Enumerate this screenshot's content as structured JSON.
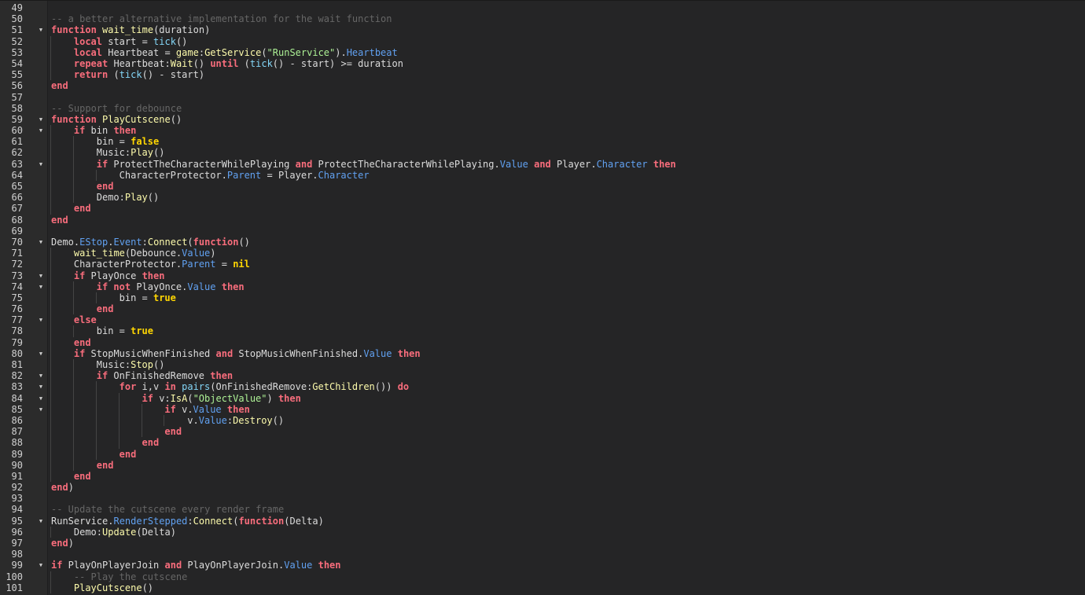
{
  "editor": {
    "background": "#252526",
    "colors": {
      "keyword": "#f86d7c",
      "bool": "#ffd602",
      "method": "#fdfbac",
      "property": "#61a1f1",
      "string": "#adf195",
      "comment": "#666666",
      "builtin": "#84d6f7",
      "text": "#dcdcdc"
    },
    "lines": [
      {
        "n": "49",
        "fold": false,
        "indent": 0,
        "tokens": []
      },
      {
        "n": "50",
        "fold": false,
        "indent": 0,
        "tokens": [
          [
            "cm",
            "-- a better alternative implementation for the wait function"
          ]
        ]
      },
      {
        "n": "51",
        "fold": true,
        "indent": 0,
        "tokens": [
          [
            "kw",
            "function"
          ],
          [
            "pl",
            " "
          ],
          [
            "fn",
            "wait_time"
          ],
          [
            "pl",
            "(duration)"
          ]
        ]
      },
      {
        "n": "52",
        "fold": false,
        "indent": 1,
        "tokens": [
          [
            "kw",
            "local"
          ],
          [
            "pl",
            " start = "
          ],
          [
            "bi",
            "tick"
          ],
          [
            "pl",
            "()"
          ]
        ]
      },
      {
        "n": "53",
        "fold": false,
        "indent": 1,
        "tokens": [
          [
            "kw",
            "local"
          ],
          [
            "pl",
            " Heartbeat = "
          ],
          [
            "fn",
            "game"
          ],
          [
            "pl",
            ":"
          ],
          [
            "fn",
            "GetService"
          ],
          [
            "pl",
            "("
          ],
          [
            "st",
            "\"RunService\""
          ],
          [
            "pl",
            ")."
          ],
          [
            "pr",
            "Heartbeat"
          ]
        ]
      },
      {
        "n": "54",
        "fold": false,
        "indent": 1,
        "tokens": [
          [
            "kw",
            "repeat"
          ],
          [
            "pl",
            " Heartbeat:"
          ],
          [
            "fn",
            "Wait"
          ],
          [
            "pl",
            "() "
          ],
          [
            "kw",
            "until"
          ],
          [
            "pl",
            " ("
          ],
          [
            "bi",
            "tick"
          ],
          [
            "pl",
            "() - start) >= duration"
          ]
        ]
      },
      {
        "n": "55",
        "fold": false,
        "indent": 1,
        "tokens": [
          [
            "kw",
            "return"
          ],
          [
            "pl",
            " ("
          ],
          [
            "bi",
            "tick"
          ],
          [
            "pl",
            "() - start)"
          ]
        ]
      },
      {
        "n": "56",
        "fold": false,
        "indent": 0,
        "tokens": [
          [
            "kw",
            "end"
          ]
        ]
      },
      {
        "n": "57",
        "fold": false,
        "indent": 0,
        "tokens": []
      },
      {
        "n": "58",
        "fold": false,
        "indent": 0,
        "tokens": [
          [
            "cm",
            "-- Support for debounce"
          ]
        ]
      },
      {
        "n": "59",
        "fold": true,
        "indent": 0,
        "tokens": [
          [
            "kw",
            "function"
          ],
          [
            "pl",
            " "
          ],
          [
            "fn",
            "PlayCutscene"
          ],
          [
            "pl",
            "()"
          ]
        ]
      },
      {
        "n": "60",
        "fold": true,
        "indent": 1,
        "tokens": [
          [
            "kw",
            "if"
          ],
          [
            "pl",
            " bin "
          ],
          [
            "kw",
            "then"
          ]
        ]
      },
      {
        "n": "61",
        "fold": false,
        "indent": 2,
        "tokens": [
          [
            "pl",
            "bin = "
          ],
          [
            "bo",
            "false"
          ]
        ]
      },
      {
        "n": "62",
        "fold": false,
        "indent": 2,
        "tokens": [
          [
            "pl",
            "Music:"
          ],
          [
            "fn",
            "Play"
          ],
          [
            "pl",
            "()"
          ]
        ]
      },
      {
        "n": "63",
        "fold": true,
        "indent": 2,
        "tokens": [
          [
            "kw",
            "if"
          ],
          [
            "pl",
            " ProtectTheCharacterWhilePlaying "
          ],
          [
            "kw",
            "and"
          ],
          [
            "pl",
            " ProtectTheCharacterWhilePlaying."
          ],
          [
            "pr",
            "Value"
          ],
          [
            "pl",
            " "
          ],
          [
            "kw",
            "and"
          ],
          [
            "pl",
            " Player."
          ],
          [
            "pr",
            "Character"
          ],
          [
            "pl",
            " "
          ],
          [
            "kw",
            "then"
          ]
        ]
      },
      {
        "n": "64",
        "fold": false,
        "indent": 3,
        "tokens": [
          [
            "pl",
            "CharacterProtector."
          ],
          [
            "pr",
            "Parent"
          ],
          [
            "pl",
            " = Player."
          ],
          [
            "pr",
            "Character"
          ]
        ]
      },
      {
        "n": "65",
        "fold": false,
        "indent": 2,
        "tokens": [
          [
            "kw",
            "end"
          ]
        ]
      },
      {
        "n": "66",
        "fold": false,
        "indent": 2,
        "tokens": [
          [
            "pl",
            "Demo:"
          ],
          [
            "fn",
            "Play"
          ],
          [
            "pl",
            "()"
          ]
        ]
      },
      {
        "n": "67",
        "fold": false,
        "indent": 1,
        "tokens": [
          [
            "kw",
            "end"
          ]
        ]
      },
      {
        "n": "68",
        "fold": false,
        "indent": 0,
        "tokens": [
          [
            "kw",
            "end"
          ]
        ]
      },
      {
        "n": "69",
        "fold": false,
        "indent": 0,
        "tokens": []
      },
      {
        "n": "70",
        "fold": true,
        "indent": 0,
        "tokens": [
          [
            "pl",
            "Demo."
          ],
          [
            "pr",
            "EStop"
          ],
          [
            "pl",
            "."
          ],
          [
            "pr",
            "Event"
          ],
          [
            "pl",
            ":"
          ],
          [
            "fn",
            "Connect"
          ],
          [
            "pl",
            "("
          ],
          [
            "kw",
            "function"
          ],
          [
            "pl",
            "()"
          ]
        ]
      },
      {
        "n": "71",
        "fold": false,
        "indent": 1,
        "tokens": [
          [
            "fn",
            "wait_time"
          ],
          [
            "pl",
            "(Debounce."
          ],
          [
            "pr",
            "Value"
          ],
          [
            "pl",
            ")"
          ]
        ]
      },
      {
        "n": "72",
        "fold": false,
        "indent": 1,
        "tokens": [
          [
            "pl",
            "CharacterProtector."
          ],
          [
            "pr",
            "Parent"
          ],
          [
            "pl",
            " = "
          ],
          [
            "bo",
            "nil"
          ]
        ]
      },
      {
        "n": "73",
        "fold": true,
        "indent": 1,
        "tokens": [
          [
            "kw",
            "if"
          ],
          [
            "pl",
            " PlayOnce "
          ],
          [
            "kw",
            "then"
          ]
        ]
      },
      {
        "n": "74",
        "fold": true,
        "indent": 2,
        "tokens": [
          [
            "kw",
            "if not"
          ],
          [
            "pl",
            " PlayOnce."
          ],
          [
            "pr",
            "Value"
          ],
          [
            "pl",
            " "
          ],
          [
            "kw",
            "then"
          ]
        ]
      },
      {
        "n": "75",
        "fold": false,
        "indent": 3,
        "tokens": [
          [
            "pl",
            "bin = "
          ],
          [
            "bo",
            "true"
          ]
        ]
      },
      {
        "n": "76",
        "fold": false,
        "indent": 2,
        "tokens": [
          [
            "kw",
            "end"
          ]
        ]
      },
      {
        "n": "77",
        "fold": true,
        "indent": 1,
        "tokens": [
          [
            "kw",
            "else"
          ]
        ]
      },
      {
        "n": "78",
        "fold": false,
        "indent": 2,
        "tokens": [
          [
            "pl",
            "bin = "
          ],
          [
            "bo",
            "true"
          ]
        ]
      },
      {
        "n": "79",
        "fold": false,
        "indent": 1,
        "tokens": [
          [
            "kw",
            "end"
          ]
        ]
      },
      {
        "n": "80",
        "fold": true,
        "indent": 1,
        "tokens": [
          [
            "kw",
            "if"
          ],
          [
            "pl",
            " StopMusicWhenFinished "
          ],
          [
            "kw",
            "and"
          ],
          [
            "pl",
            " StopMusicWhenFinished."
          ],
          [
            "pr",
            "Value"
          ],
          [
            "pl",
            " "
          ],
          [
            "kw",
            "then"
          ]
        ]
      },
      {
        "n": "81",
        "fold": false,
        "indent": 2,
        "tokens": [
          [
            "pl",
            "Music:"
          ],
          [
            "fn",
            "Stop"
          ],
          [
            "pl",
            "()"
          ]
        ]
      },
      {
        "n": "82",
        "fold": true,
        "indent": 2,
        "tokens": [
          [
            "kw",
            "if"
          ],
          [
            "pl",
            " OnFinishedRemove "
          ],
          [
            "kw",
            "then"
          ]
        ]
      },
      {
        "n": "83",
        "fold": true,
        "indent": 3,
        "tokens": [
          [
            "kw",
            "for"
          ],
          [
            "pl",
            " i,v "
          ],
          [
            "kw",
            "in"
          ],
          [
            "pl",
            " "
          ],
          [
            "bi",
            "pairs"
          ],
          [
            "pl",
            "(OnFinishedRemove:"
          ],
          [
            "fn",
            "GetChildren"
          ],
          [
            "pl",
            "()) "
          ],
          [
            "kw",
            "do"
          ]
        ]
      },
      {
        "n": "84",
        "fold": true,
        "indent": 4,
        "tokens": [
          [
            "kw",
            "if"
          ],
          [
            "pl",
            " v:"
          ],
          [
            "fn",
            "IsA"
          ],
          [
            "pl",
            "("
          ],
          [
            "st",
            "\"ObjectValue\""
          ],
          [
            "pl",
            ") "
          ],
          [
            "kw",
            "then"
          ]
        ]
      },
      {
        "n": "85",
        "fold": true,
        "indent": 5,
        "tokens": [
          [
            "kw",
            "if"
          ],
          [
            "pl",
            " v."
          ],
          [
            "pr",
            "Value"
          ],
          [
            "pl",
            " "
          ],
          [
            "kw",
            "then"
          ]
        ]
      },
      {
        "n": "86",
        "fold": false,
        "indent": 6,
        "tokens": [
          [
            "pl",
            "v."
          ],
          [
            "pr",
            "Value"
          ],
          [
            "pl",
            ":"
          ],
          [
            "fn",
            "Destroy"
          ],
          [
            "pl",
            "()"
          ]
        ]
      },
      {
        "n": "87",
        "fold": false,
        "indent": 5,
        "tokens": [
          [
            "kw",
            "end"
          ]
        ]
      },
      {
        "n": "88",
        "fold": false,
        "indent": 4,
        "tokens": [
          [
            "kw",
            "end"
          ]
        ]
      },
      {
        "n": "89",
        "fold": false,
        "indent": 3,
        "tokens": [
          [
            "kw",
            "end"
          ]
        ]
      },
      {
        "n": "90",
        "fold": false,
        "indent": 2,
        "tokens": [
          [
            "kw",
            "end"
          ]
        ]
      },
      {
        "n": "91",
        "fold": false,
        "indent": 1,
        "tokens": [
          [
            "kw",
            "end"
          ]
        ]
      },
      {
        "n": "92",
        "fold": false,
        "indent": 0,
        "tokens": [
          [
            "kw",
            "end"
          ],
          [
            "pl",
            ")"
          ]
        ]
      },
      {
        "n": "93",
        "fold": false,
        "indent": 0,
        "tokens": []
      },
      {
        "n": "94",
        "fold": false,
        "indent": 0,
        "tokens": [
          [
            "cm",
            "-- Update the cutscene every render frame"
          ]
        ]
      },
      {
        "n": "95",
        "fold": true,
        "indent": 0,
        "tokens": [
          [
            "pl",
            "RunService."
          ],
          [
            "pr",
            "RenderStepped"
          ],
          [
            "pl",
            ":"
          ],
          [
            "fn",
            "Connect"
          ],
          [
            "pl",
            "("
          ],
          [
            "kw",
            "function"
          ],
          [
            "pl",
            "(Delta)"
          ]
        ]
      },
      {
        "n": "96",
        "fold": false,
        "indent": 1,
        "tokens": [
          [
            "pl",
            "Demo:"
          ],
          [
            "fn",
            "Update"
          ],
          [
            "pl",
            "(Delta)"
          ]
        ]
      },
      {
        "n": "97",
        "fold": false,
        "indent": 0,
        "tokens": [
          [
            "kw",
            "end"
          ],
          [
            "pl",
            ")"
          ]
        ]
      },
      {
        "n": "98",
        "fold": false,
        "indent": 0,
        "tokens": []
      },
      {
        "n": "99",
        "fold": true,
        "indent": 0,
        "tokens": [
          [
            "kw",
            "if"
          ],
          [
            "pl",
            " PlayOnPlayerJoin "
          ],
          [
            "kw",
            "and"
          ],
          [
            "pl",
            " PlayOnPlayerJoin."
          ],
          [
            "pr",
            "Value"
          ],
          [
            "pl",
            " "
          ],
          [
            "kw",
            "then"
          ]
        ]
      },
      {
        "n": "100",
        "fold": false,
        "indent": 1,
        "tokens": [
          [
            "cm",
            "-- Play the cutscene"
          ]
        ]
      },
      {
        "n": "101",
        "fold": false,
        "indent": 1,
        "tokens": [
          [
            "fn",
            "PlayCutscene"
          ],
          [
            "pl",
            "()"
          ]
        ]
      }
    ]
  }
}
